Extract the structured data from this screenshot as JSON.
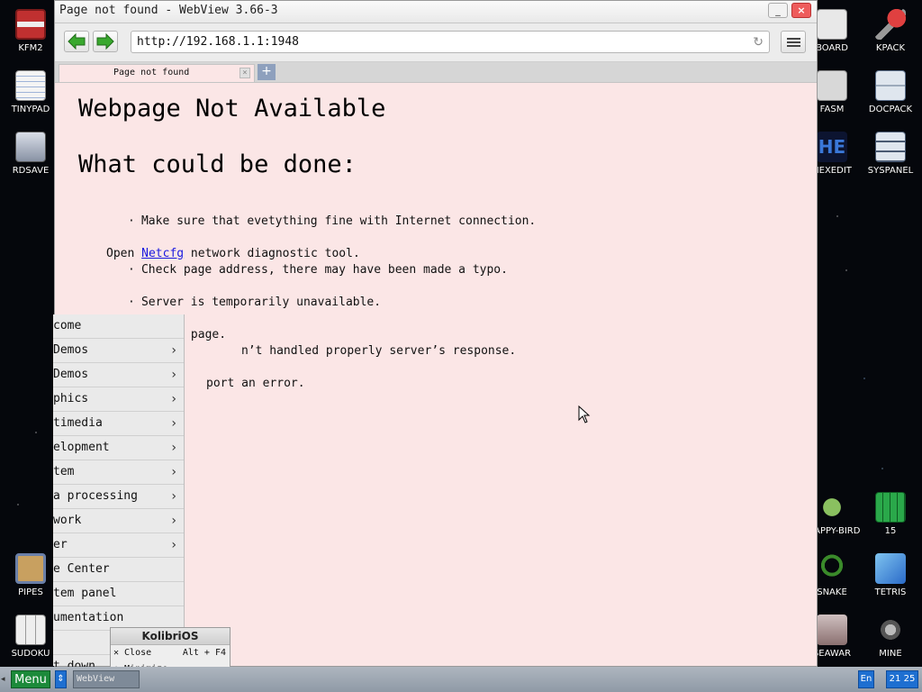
{
  "desktop": {
    "left_icons": [
      {
        "label": "KFM2",
        "icon": "floppy-disk-icon",
        "color": "#c03030"
      },
      {
        "label": "TINYPAD",
        "icon": "notepad-icon",
        "color": "#f2f2f2"
      },
      {
        "label": "RDSAVE",
        "icon": "ramdisk-save-icon",
        "color": "#b0b8c8"
      },
      {
        "label": "PIPES",
        "icon": "pipes-icon",
        "color": "#c8a060"
      },
      {
        "label": "SUDOKU",
        "icon": "sudoku-grid-icon",
        "color": "#eeeeee"
      }
    ],
    "right_icons": [
      {
        "label": "BOARD",
        "icon": "board-icon",
        "color": "#e8e8e8"
      },
      {
        "label": "KPACK",
        "icon": "wrench-icon",
        "color": "#d03030"
      },
      {
        "label": "FASM",
        "icon": "fasm-icon",
        "color": "#d8d8d8"
      },
      {
        "label": "DOCPACK",
        "icon": "cabinet-icon",
        "color": "#dfe6ee"
      },
      {
        "label": "HEXEDIT",
        "icon": "hex-editor-icon",
        "color": "#3a78d8"
      },
      {
        "label": "SYSPANEL",
        "icon": "sliders-icon",
        "color": "#dfe6ee"
      },
      {
        "label": "FLAPPY-BIRD",
        "icon": "bird-icon",
        "color": "#8ac060"
      },
      {
        "label": "15",
        "icon": "fifteen-puzzle-icon",
        "color": "#2aa84a"
      },
      {
        "label": "SNAKE",
        "icon": "snake-icon",
        "color": "#3a8a2a"
      },
      {
        "label": "TETRIS",
        "icon": "tetris-icon",
        "color": "#3a8ad8"
      },
      {
        "label": "SEAWAR",
        "icon": "sea-war-icon",
        "color": "#d0c0c0"
      },
      {
        "label": "MINE",
        "icon": "mine-icon",
        "color": "#888888"
      }
    ]
  },
  "window": {
    "title": "Page not found - WebView 3.66-3",
    "minimize_label": "_",
    "close_label": "×"
  },
  "toolbar": {
    "url": "http://192.168.1.1:1948",
    "reload_icon": "↻"
  },
  "tabs": [
    {
      "label": "Page not found",
      "close": "×"
    }
  ],
  "new_tab_label": "+",
  "page": {
    "heading": "Webpage Not Available",
    "subheading": "What could be done:",
    "bullet": "·",
    "items": [
      {
        "line1": "Make sure that evetything fine with Internet connection.",
        "line2_pre": "Open ",
        "line2_link": "Netcfg",
        "line2_post": " network diagnostic tool."
      },
      {
        "line1": "Check page address, there may have been made a typo."
      },
      {
        "line1": "Server is temporarily unavailable.",
        "line2": "Refresh the page."
      },
      {
        "line1_visible": "n’t handled properly server’s response.",
        "line2_visible": "port an error."
      }
    ]
  },
  "start_menu": {
    "items": [
      {
        "label": "come",
        "has_submenu": false
      },
      {
        "label": " Demos",
        "has_submenu": true
      },
      {
        "label": " Demos",
        "has_submenu": true
      },
      {
        "label": "phics",
        "has_submenu": true
      },
      {
        "label": "timedia",
        "has_submenu": true
      },
      {
        "label": "elopment",
        "has_submenu": true
      },
      {
        "label": "tem",
        "has_submenu": true
      },
      {
        "label": "a processing",
        "has_submenu": true
      },
      {
        "label": "work",
        "has_submenu": true
      },
      {
        "label": "er",
        "has_submenu": true
      },
      {
        "label": "e Center",
        "has_submenu": false
      },
      {
        "label": "tem panel",
        "has_submenu": false
      },
      {
        "label": "umentation",
        "has_submenu": false
      },
      {
        "label": "",
        "has_submenu": false
      },
      {
        "label": "t down",
        "has_submenu": false
      }
    ],
    "arrow": "›"
  },
  "kolibri_popup": {
    "title": "KolibriOS",
    "rows": [
      {
        "left": "✕ Close",
        "right": "Alt + F4"
      },
      {
        "left": "↓ Minimize",
        "right": ""
      }
    ]
  },
  "taskbar": {
    "menu_label": "Menu",
    "swap_label": "⇕",
    "task_label": "WebView",
    "lang": "En",
    "clock": "21 25"
  },
  "colors": {
    "page_background": "#fbe6e6",
    "link": "#1a1adf",
    "menu_button": "#1c8a3a",
    "taskbar_accent": "#1e6fd1"
  }
}
